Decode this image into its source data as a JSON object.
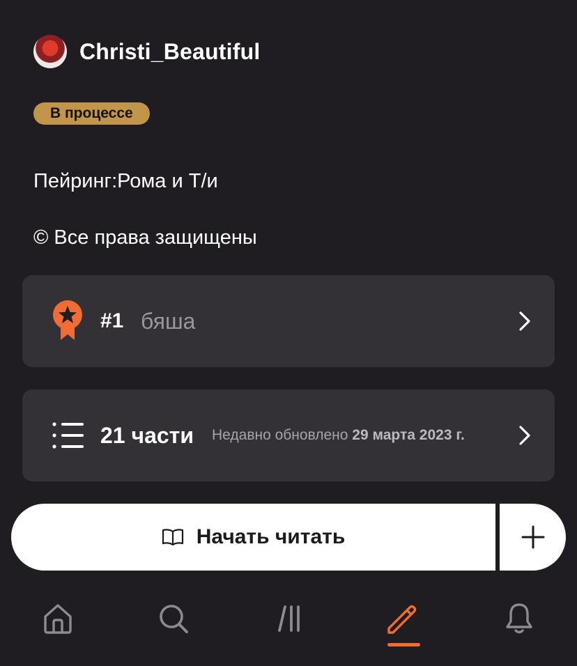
{
  "author": {
    "name": "Christi_Beautiful"
  },
  "status": {
    "label": "В процессе"
  },
  "description": {
    "pairing": "Пейринг:Рома и Т/и",
    "rights": "© Все права защищены"
  },
  "ranking": {
    "number": "#1",
    "tag": "бяша",
    "icon": "ribbon-star-icon"
  },
  "parts": {
    "count_label": "21 части",
    "updated_prefix": "Недавно обновлено",
    "updated_date": "29 марта 2023 г.",
    "icon": "list-icon"
  },
  "actions": {
    "read_label": "Начать читать",
    "read_icon": "book-icon",
    "add_icon": "plus-icon"
  },
  "nav": {
    "items": [
      {
        "icon": "home-icon"
      },
      {
        "icon": "search-icon"
      },
      {
        "icon": "library-icon"
      },
      {
        "icon": "write-icon",
        "active": true
      },
      {
        "icon": "bell-icon"
      }
    ]
  },
  "colors": {
    "background": "#1f1d21",
    "card": "#333136",
    "badge": "#c1954a",
    "accent": "#f06c33"
  }
}
